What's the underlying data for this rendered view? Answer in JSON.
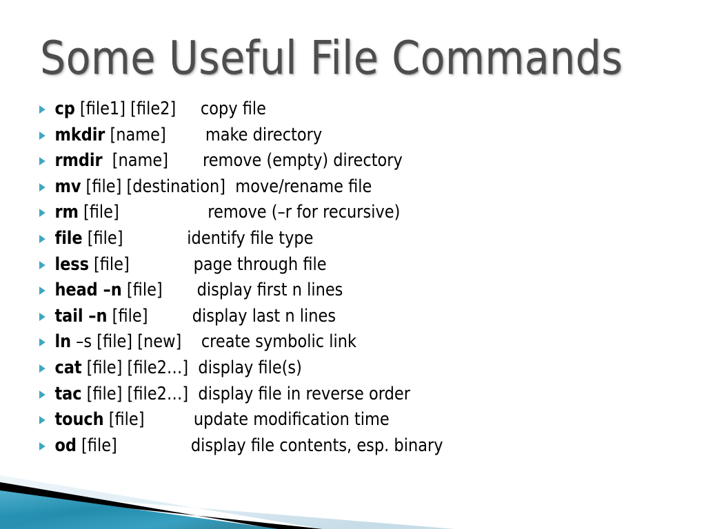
{
  "slide": {
    "title": "Some Useful File Commands",
    "title_color": "#4d4d4d",
    "background_color": "#ffffff",
    "bullet_color": "#3fa7c0"
  },
  "commands": [
    {
      "name": "cp",
      "flag": "",
      "flag_bold": false,
      "args": " [file1] [file2]",
      "gap": "     ",
      "desc": "copy file"
    },
    {
      "name": "mkdir",
      "flag": "",
      "flag_bold": false,
      "args": " [name]",
      "gap": "        ",
      "desc": "make directory"
    },
    {
      "name": "rmdir",
      "flag": "",
      "flag_bold": false,
      "args": "  [name]",
      "gap": "       ",
      "desc": "remove (empty) directory"
    },
    {
      "name": "mv",
      "flag": "",
      "flag_bold": false,
      "args": " [file] [destination]",
      "gap": "  ",
      "desc": "move/rename file"
    },
    {
      "name": "rm",
      "flag": "",
      "flag_bold": false,
      "args": " [file]",
      "gap": "                  ",
      "desc": "remove (–r for recursive)"
    },
    {
      "name": "file",
      "flag": "",
      "flag_bold": false,
      "args": " [file]",
      "gap": "             ",
      "desc": "identify file type"
    },
    {
      "name": "less",
      "flag": "",
      "flag_bold": false,
      "args": " [file]",
      "gap": "             ",
      "desc": "page through file"
    },
    {
      "name": "head",
      "flag": " –n",
      "flag_bold": true,
      "args": " [file]",
      "gap": "       ",
      "desc": "display first n lines"
    },
    {
      "name": "tail",
      "flag": " –n",
      "flag_bold": true,
      "args": " [file]",
      "gap": "         ",
      "desc": "display last n lines"
    },
    {
      "name": "ln",
      "flag": " –s",
      "flag_bold": false,
      "args": " [file] [new]",
      "gap": "    ",
      "desc": "create symbolic link"
    },
    {
      "name": "cat",
      "flag": "",
      "flag_bold": false,
      "args": " [file] [file2…]",
      "gap": "  ",
      "desc": "display file(s)"
    },
    {
      "name": "tac",
      "flag": "",
      "flag_bold": false,
      "args": " [file] [file2…]",
      "gap": "  ",
      "desc": "display file in reverse order"
    },
    {
      "name": "touch",
      "flag": "",
      "flag_bold": false,
      "args": " [file]",
      "gap": "          ",
      "desc": "update modification time"
    },
    {
      "name": "od",
      "flag": "",
      "flag_bold": false,
      "args": " [file]",
      "gap": "               ",
      "desc": "display file contents, esp. binary"
    }
  ],
  "decoration": {
    "teal_light": "#2d9dc0",
    "teal_mid": "#1b86a8",
    "teal_dark": "#14708f",
    "black": "#000000",
    "pale_blue": "#e2eef6",
    "pale_blue_edge": "#c9dee9"
  }
}
